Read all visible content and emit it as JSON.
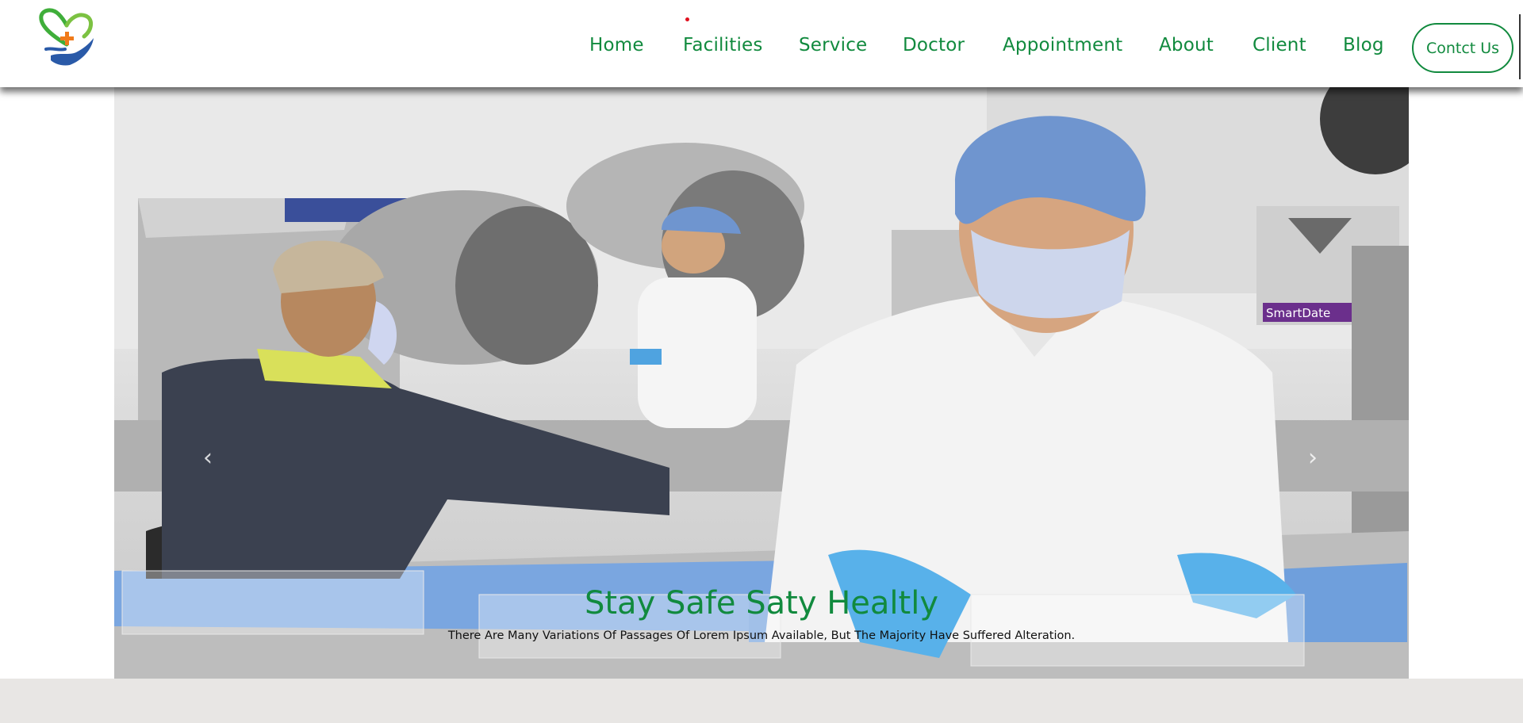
{
  "header": {
    "logo_icon": "heart-hand-cross-icon",
    "nav": [
      {
        "label": "Home"
      },
      {
        "label": "Facilities"
      },
      {
        "label": "Service"
      },
      {
        "label": "Doctor"
      },
      {
        "label": "Appointment"
      },
      {
        "label": "About"
      },
      {
        "label": "Client"
      },
      {
        "label": "Blog"
      }
    ],
    "contact_label": "Contct Us"
  },
  "hero": {
    "title": "Stay Safe Saty Healtly",
    "subtitle": "There Are Many Variations Of Passages Of Lorem Ipsum Available, But The Majority Have Suffered Alteration.",
    "prev_icon": "chevron-left-icon",
    "next_icon": "chevron-right-icon",
    "machine_label": "SmartDate"
  },
  "colors": {
    "brand_green": "#118a3e",
    "accent_red": "#e0101e",
    "logo_blue": "#2a5aa8",
    "footer_band": "#e8e6e4"
  }
}
